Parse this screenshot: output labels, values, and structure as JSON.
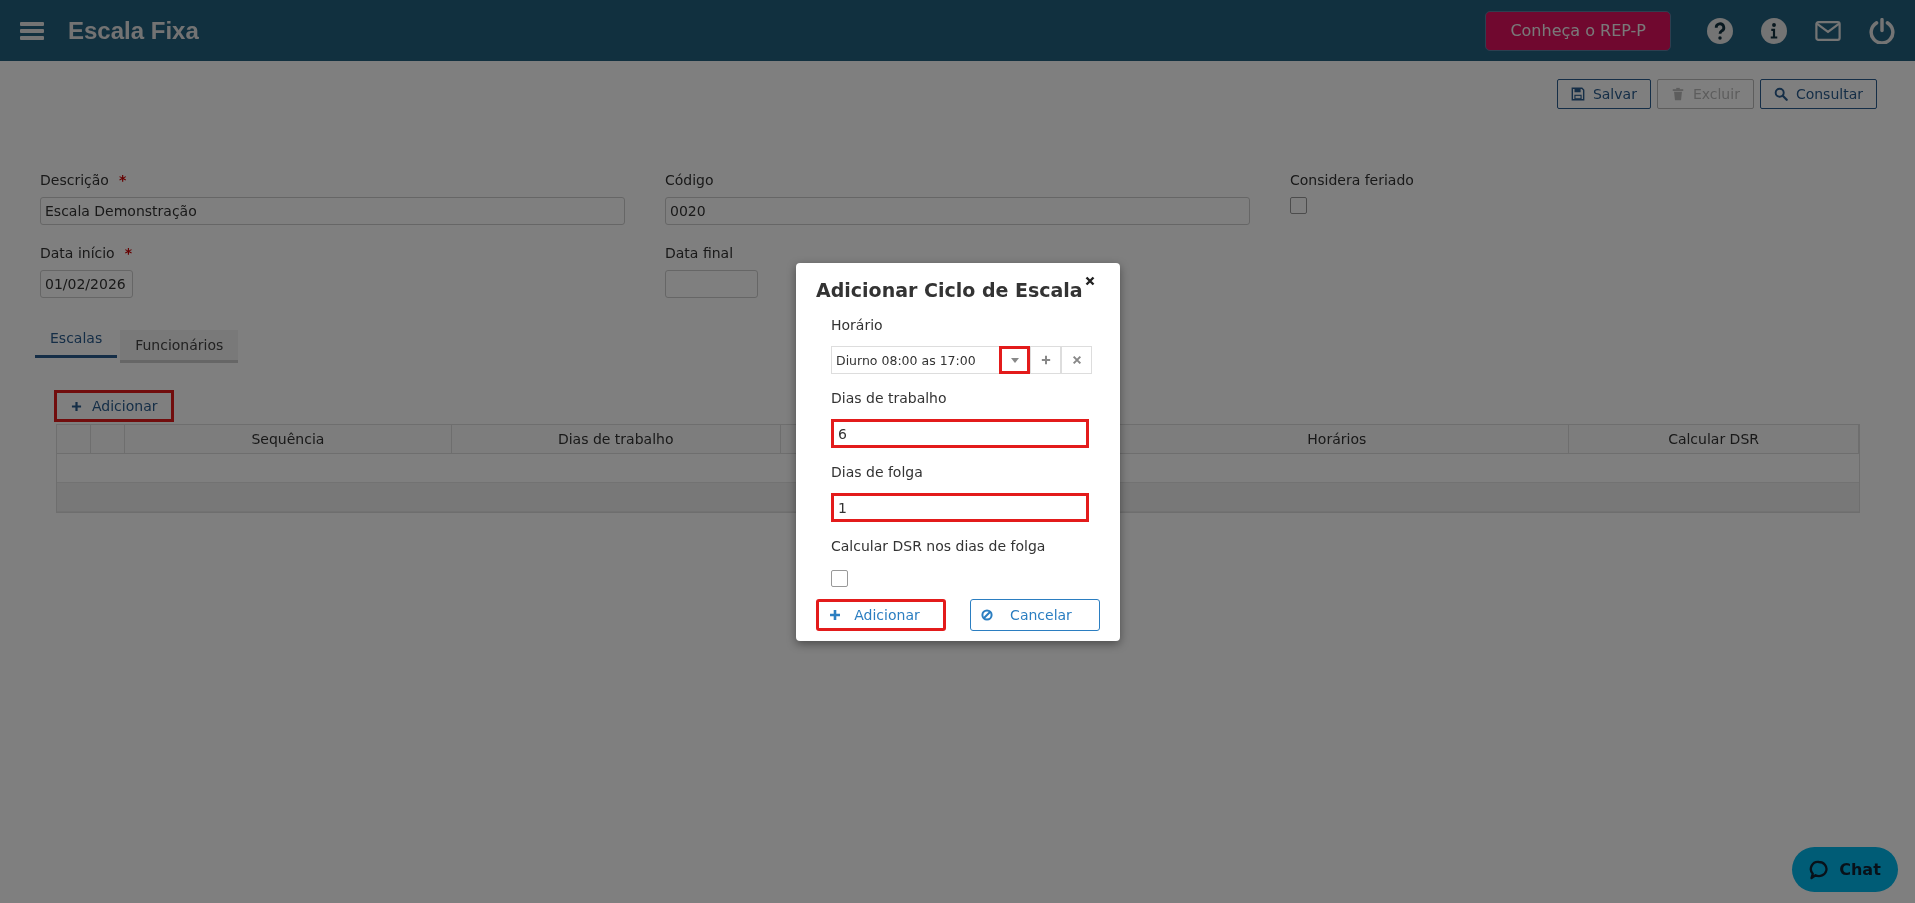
{
  "header": {
    "title": "Escala Fixa",
    "promo_button": "Conheça o REP-P"
  },
  "toolbar": [
    {
      "label": "Salvar",
      "kind": "save",
      "disabled": false
    },
    {
      "label": "Excluir",
      "kind": "delete",
      "disabled": true
    },
    {
      "label": "Consultar",
      "kind": "search",
      "disabled": false
    }
  ],
  "fields": [
    {
      "label": "Descrição",
      "required_mark": "*",
      "value": "Escala Demonstração",
      "kind": "text"
    },
    {
      "label": "Código",
      "value": "0020",
      "kind": "text"
    },
    {
      "label": "Considera feriado",
      "kind": "checkbox",
      "checked": false
    },
    {
      "label": "Data início",
      "required_mark": "*",
      "value": "01/02/2026",
      "kind": "date"
    },
    {
      "label": "Data final",
      "kind": "date"
    }
  ],
  "tabs": [
    {
      "label": "Escalas",
      "selected": true
    },
    {
      "label": "Funcionários",
      "selected": false
    }
  ],
  "add_button": {
    "label": "Adicionar",
    "highlighted": true
  },
  "table": {
    "columns": [
      "Sequência",
      "Dias de trabalho",
      "Horários",
      "Calcular DSR"
    ]
  },
  "dialog": {
    "title": "Adicionar Ciclo de Escala",
    "horario": {
      "label": "Horário",
      "value": "Diurno 08:00 as 17:00",
      "caret_highlighted": true
    },
    "dias_trabalho": {
      "label": "Dias de trabalho",
      "value": "6",
      "highlighted": true
    },
    "dias_folga": {
      "label": "Dias de folga",
      "value": "1",
      "highlighted": true
    },
    "calcular_dsr": {
      "label": "Calcular DSR nos dias de folga",
      "checked": false
    },
    "buttons": [
      {
        "label": "Adicionar",
        "kind": "add",
        "highlighted": true
      },
      {
        "label": "Cancelar",
        "kind": "cancel",
        "highlighted": false
      }
    ]
  },
  "chat": {
    "label": "Chat"
  }
}
